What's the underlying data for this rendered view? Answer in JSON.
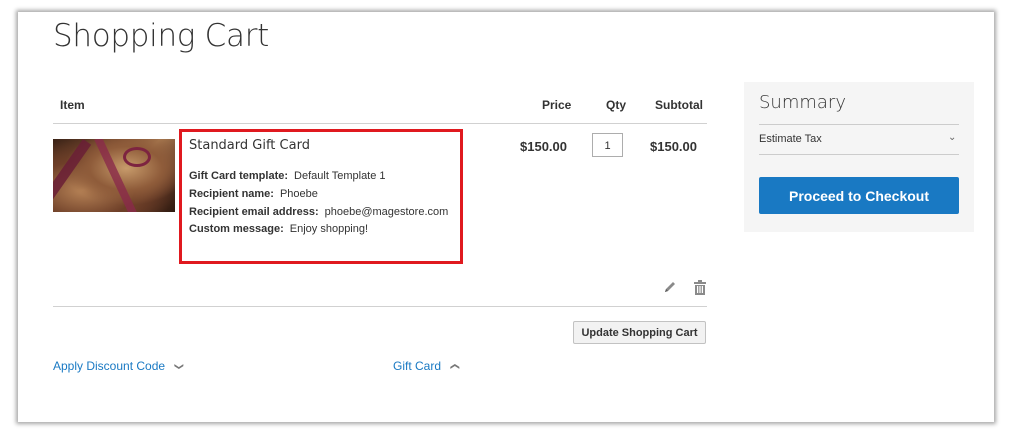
{
  "page": {
    "title": "Shopping Cart"
  },
  "cart": {
    "headers": {
      "item": "Item",
      "price": "Price",
      "qty": "Qty",
      "subtotal": "Subtotal"
    },
    "items": [
      {
        "name": "Standard Gift Card",
        "options": [
          {
            "label": "Gift Card template:",
            "value": "Default Template 1"
          },
          {
            "label": "Recipient name:",
            "value": "Phoebe"
          },
          {
            "label": "Recipient email address:",
            "value": "phoebe@magestore.com"
          },
          {
            "label": "Custom message:",
            "value": "Enjoy shopping!"
          }
        ],
        "price": "$150.00",
        "qty": "1",
        "subtotal": "$150.00"
      }
    ],
    "update_label": "Update Shopping Cart",
    "discount_label": "Apply Discount Code",
    "gift_card_label": "Gift Card"
  },
  "summary": {
    "title": "Summary",
    "estimate_tax": "Estimate Tax",
    "checkout_label": "Proceed to Checkout"
  },
  "colors": {
    "accent": "#1979c3",
    "highlight": "#e0191f"
  },
  "icons": [
    "edit-icon",
    "trash-icon",
    "chevron-down-icon",
    "chevron-up-icon"
  ]
}
